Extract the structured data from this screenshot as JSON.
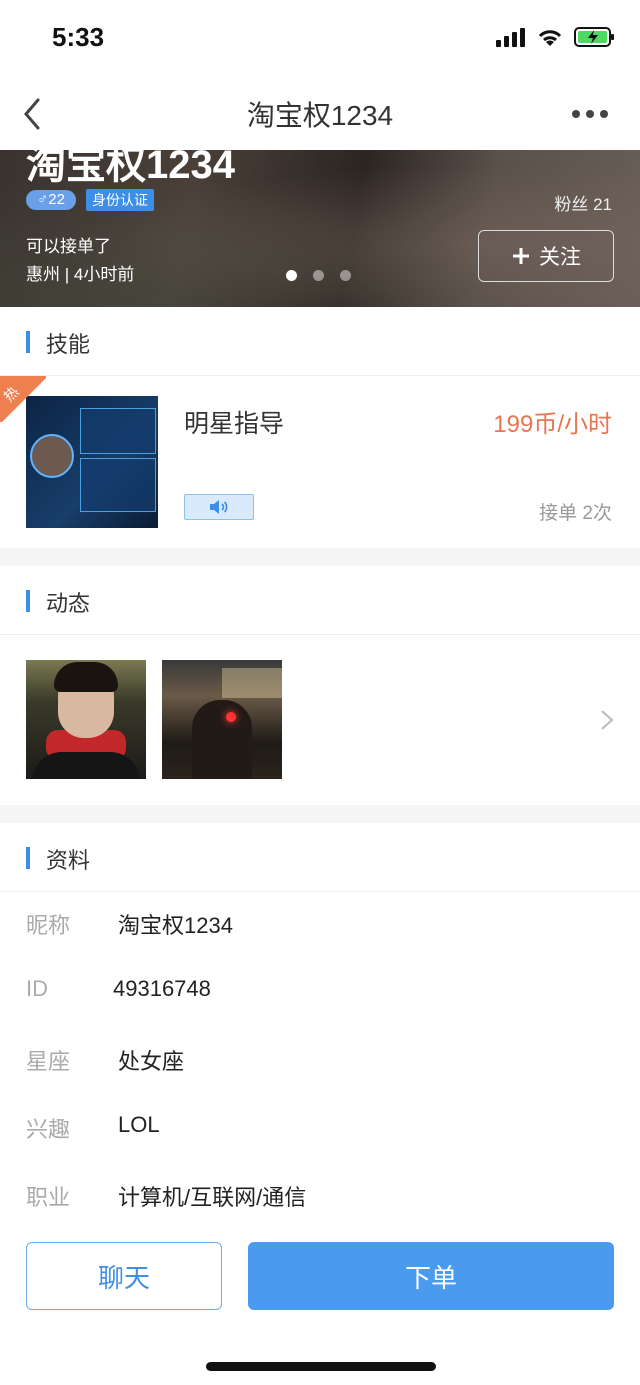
{
  "status_bar": {
    "time": "5:33"
  },
  "nav": {
    "title": "淘宝权1234"
  },
  "hero": {
    "name": "淘宝权1234",
    "gender_age": "♂22",
    "verify_label": "身份认证",
    "fans": "粉丝 21",
    "status_text": "可以接单了",
    "location_time": "惠州 | 4小时前",
    "follow_label": "关注"
  },
  "sections": {
    "skills": "技能",
    "moments": "动态",
    "profile": "资料"
  },
  "skill": {
    "hot_tag": "热",
    "name": "明星指导",
    "price": "199币/小时",
    "orders": "接单 2次"
  },
  "profile": {
    "rows": [
      {
        "label": "昵称",
        "value": "淘宝权1234"
      },
      {
        "label": "ID",
        "value": "49316748"
      },
      {
        "label": "星座",
        "value": "处女座"
      },
      {
        "label": "兴趣",
        "value": "LOL"
      },
      {
        "label": "职业",
        "value": "计算机/互联网/通信"
      }
    ]
  },
  "actions": {
    "chat_label": "聊天",
    "order_label": "下单"
  },
  "colors": {
    "accent": "#3d8ee6",
    "price": "#e87450",
    "order_button": "#4a9af0",
    "hot_tag": "#ee8050"
  }
}
